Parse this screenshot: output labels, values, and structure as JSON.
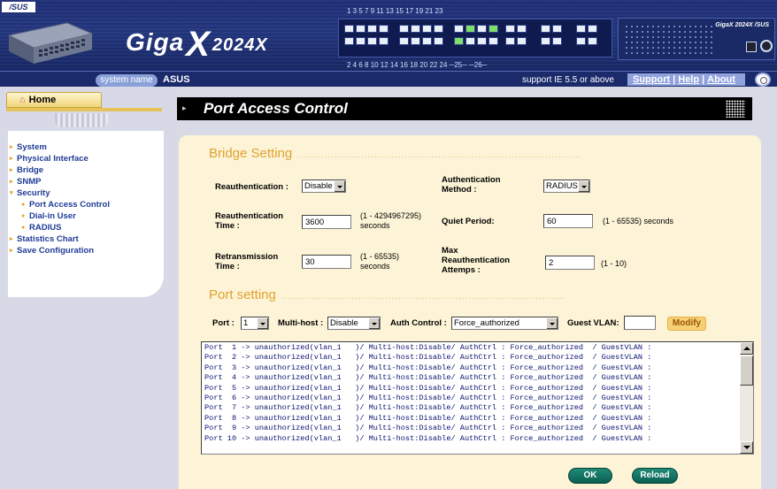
{
  "header": {
    "asus_logo": "/SUS",
    "product_name": "Giga",
    "product_x": "X",
    "product_model": "2024X",
    "port_numbers_top": "1    3    5    7     9   11   13   15    17   19   21  23",
    "port_numbers_bottom": "2    4    6    8     10  12   14   16    18   20   22  24   ─25─    ─26─",
    "chassis_brand": "GigaX 2024X /SUS"
  },
  "infobar": {
    "system_name_label": "system name",
    "system_name_value": "ASUS",
    "support_note": "support IE 5.5 or above",
    "links": {
      "support": "Support",
      "help": "Help",
      "about": "About",
      "sep": "|"
    }
  },
  "sidebar": {
    "home_label": "Home",
    "items": [
      {
        "label": "System",
        "sub": false
      },
      {
        "label": "Physical Interface",
        "sub": false
      },
      {
        "label": "Bridge",
        "sub": false
      },
      {
        "label": "SNMP",
        "sub": false
      },
      {
        "label": "Security",
        "sub": false
      },
      {
        "label": "Port Access Control",
        "sub": true
      },
      {
        "label": "Dial-in User",
        "sub": true
      },
      {
        "label": "RADIUS",
        "sub": true
      },
      {
        "label": "Statistics Chart",
        "sub": false
      },
      {
        "label": "Save Configuration",
        "sub": false
      }
    ]
  },
  "page_title": "Port Access Control",
  "bridge": {
    "section_title": "Bridge Setting",
    "reauth_label": "Reauthentication :",
    "reauth_value": "Disable",
    "auth_method_label": "Authentication Method :",
    "auth_method_value": "RADIUS",
    "reauth_time_label": "Reauthentication Time :",
    "reauth_time_value": "3600",
    "reauth_time_note": "(1 - 4294967295) seconds",
    "quiet_period_label": "Quiet Period:",
    "quiet_period_value": "60",
    "quiet_period_note": "(1 - 65535) seconds",
    "retrans_time_label": "Retransmission Time :",
    "retrans_time_value": "30",
    "retrans_time_note": "(1 - 65535) seconds",
    "max_reauth_label": "Max Reauthentication Attemps :",
    "max_reauth_value": "2",
    "max_reauth_note": "(1 - 10)"
  },
  "port_setting": {
    "section_title": "Port setting",
    "port_label": "Port :",
    "port_value": "1",
    "multihost_label": "Multi-host :",
    "multihost_value": "Disable",
    "auth_control_label": "Auth Control :",
    "auth_control_value": "Force_authorized",
    "guest_vlan_label": "Guest VLAN:",
    "guest_vlan_value": "",
    "modify_button": "Modify"
  },
  "port_list": [
    "Port  1 -> unauthorized(vlan_1   )/ Multi-host:Disable/ AuthCtrl : Force_authorized  / GuestVLAN :",
    "Port  2 -> unauthorized(vlan_1   )/ Multi-host:Disable/ AuthCtrl : Force_authorized  / GuestVLAN :",
    "Port  3 -> unauthorized(vlan_1   )/ Multi-host:Disable/ AuthCtrl : Force_authorized  / GuestVLAN :",
    "Port  4 -> unauthorized(vlan_1   )/ Multi-host:Disable/ AuthCtrl : Force_authorized  / GuestVLAN :",
    "Port  5 -> unauthorized(vlan_1   )/ Multi-host:Disable/ AuthCtrl : Force_authorized  / GuestVLAN :",
    "Port  6 -> unauthorized(vlan_1   )/ Multi-host:Disable/ AuthCtrl : Force_authorized  / GuestVLAN :",
    "Port  7 -> unauthorized(vlan_1   )/ Multi-host:Disable/ AuthCtrl : Force_authorized  / GuestVLAN :",
    "Port  8 -> unauthorized(vlan_1   )/ Multi-host:Disable/ AuthCtrl : Force_authorized  / GuestVLAN :",
    "Port  9 -> unauthorized(vlan_1   )/ Multi-host:Disable/ AuthCtrl : Force_authorized  / GuestVLAN :",
    "Port 10 -> unauthorized(vlan_1   )/ Multi-host:Disable/ AuthCtrl : Force_authorized  / GuestVLAN :"
  ],
  "buttons": {
    "ok": "OK",
    "reload": "Reload"
  },
  "colors": {
    "header_blue": "#1e2f78",
    "section_orange": "#e0a22e",
    "panel_cream": "#fdf4d7",
    "nav_blue": "#1f3b96",
    "button_teal": "#0b5f52"
  }
}
